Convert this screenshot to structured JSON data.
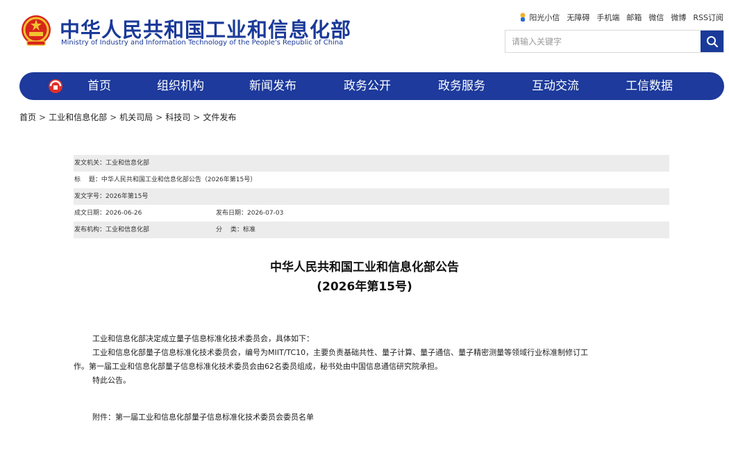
{
  "header": {
    "title": "中华人民共和国工业和信息化部",
    "subtitle": "Ministry of Industry and Information Technology of the People's Republic of China",
    "toplinks": [
      "阳光小信",
      "无障碍",
      "手机端",
      "邮箱",
      "微信",
      "微博",
      "RSS订阅"
    ],
    "search": {
      "placeholder": "请输入关键字"
    }
  },
  "nav": {
    "items": [
      "首页",
      "组织机构",
      "新闻发布",
      "政务公开",
      "政务服务",
      "互动交流",
      "工信数据"
    ]
  },
  "breadcrumb": [
    "首页",
    "工业和信息化部",
    "机关司局",
    "科技司",
    "文件发布"
  ],
  "breadcrumb_sep": ">",
  "meta": {
    "issuer": "发文机关：工业和信息化部",
    "title": "标　 题：中华人民共和国工业和信息化部公告（2026年第15号）",
    "doc_no": "发文字号：2026年第15号",
    "created": "成文日期：2026-06-26",
    "published": "发布日期：2026-07-03",
    "org": "发布机构：工业和信息化部",
    "category": "分　 类：标准"
  },
  "article": {
    "title_line1": "中华人民共和国工业和信息化部公告",
    "title_line2": "(2026年第15号)",
    "p1": "工业和信息化部决定成立量子信息标准化技术委员会，具体如下：",
    "p2a": "工业和信息化部量子信息标准化技术委员会，编号为MIIT/TC10，主要负责基础共性、量子计算、量子通信、量子精密测量等领域行业标准制修订工",
    "p2b": "作。第一届工业和信息化部量子信息标准化技术委员会由62名委员组成，秘书处由中国信息通信研究院承担。",
    "p3": "特此公告。",
    "attachment": "附件：第一届工业和信息化部量子信息标准化技术委员会委员名单"
  },
  "colors": {
    "brand": "#1d3a9c",
    "shade": "#ececec"
  }
}
